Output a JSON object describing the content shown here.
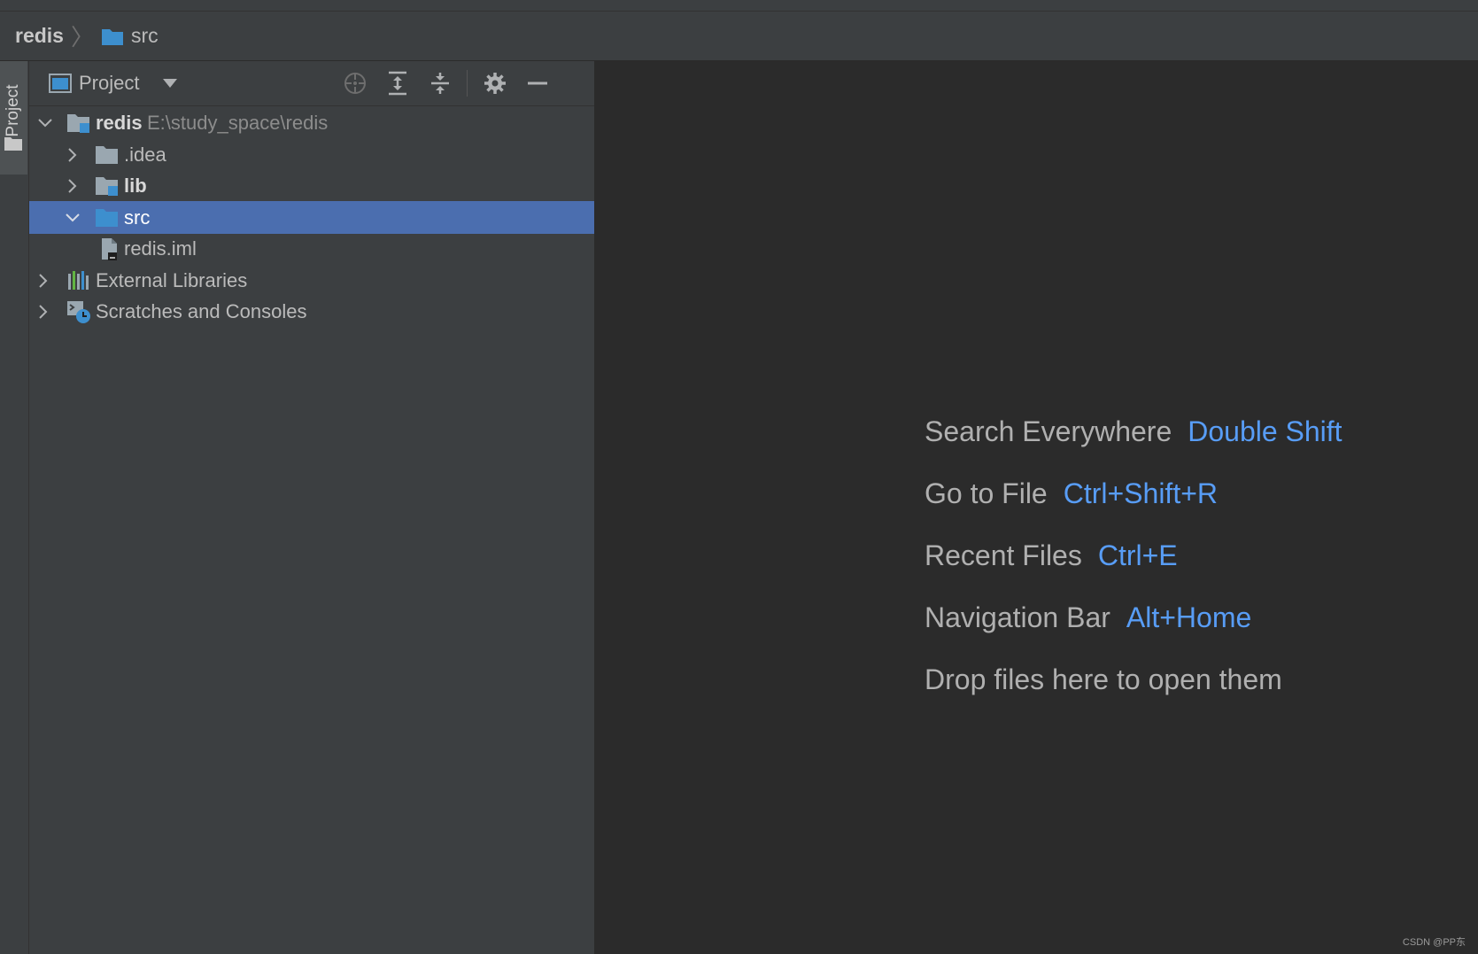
{
  "navbar": {
    "root": "redis",
    "separator": "〉",
    "current": "src"
  },
  "left_strip": {
    "tab_label": "Project"
  },
  "project_panel": {
    "title": "Project",
    "tools": {
      "locate_icon": "crosshair-icon",
      "expand_icon": "expand-all-icon",
      "collapse_icon": "collapse-all-icon",
      "settings_icon": "gear-icon",
      "hide_icon": "minimize-icon"
    },
    "tree": [
      {
        "label": "redis",
        "path": "E:\\study_space\\redis",
        "expanded": true,
        "icon": "module-folder-icon"
      },
      {
        "label": ".idea",
        "expanded": false,
        "icon": "folder-icon"
      },
      {
        "label": "lib",
        "expanded": false,
        "icon": "library-folder-icon"
      },
      {
        "label": "src",
        "expanded": true,
        "selected": true,
        "icon": "source-folder-icon"
      },
      {
        "label": "redis.iml",
        "icon": "iml-file-icon"
      },
      {
        "label": "External Libraries",
        "expanded": false,
        "icon": "libraries-icon"
      },
      {
        "label": "Scratches and Consoles",
        "expanded": false,
        "icon": "scratches-icon"
      }
    ]
  },
  "editor": {
    "hints": [
      {
        "label": "Search Everywhere",
        "shortcut": "Double Shift"
      },
      {
        "label": "Go to File",
        "shortcut": "Ctrl+Shift+R"
      },
      {
        "label": "Recent Files",
        "shortcut": "Ctrl+E"
      },
      {
        "label": "Navigation Bar",
        "shortcut": "Alt+Home"
      },
      {
        "label": "Drop files here to open them",
        "shortcut": ""
      }
    ]
  },
  "watermark": "CSDN @PP东",
  "colors": {
    "selection": "#4b6eaf",
    "shortcut": "#589df6",
    "folder_blue": "#3d8fce"
  }
}
